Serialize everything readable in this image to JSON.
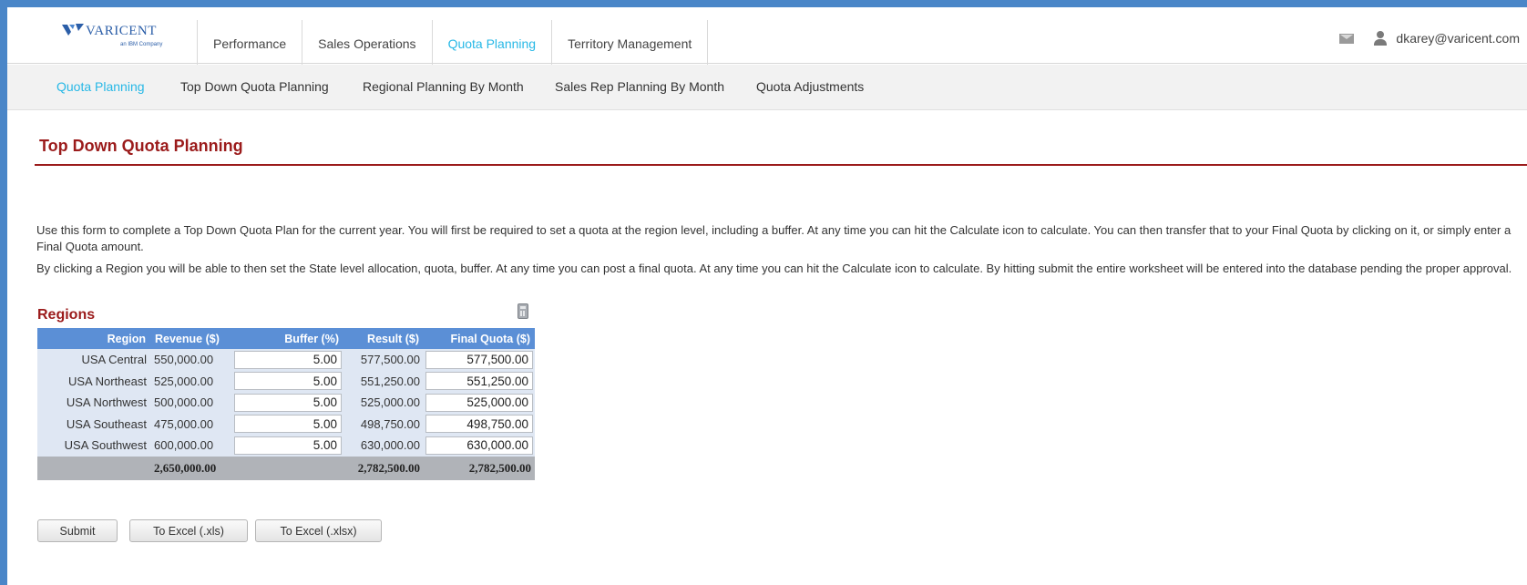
{
  "brand": {
    "name": "VARICENT",
    "tagline": "an IBM Company"
  },
  "topnav": {
    "tabs": [
      {
        "label": "Performance",
        "active": false
      },
      {
        "label": "Sales Operations",
        "active": false
      },
      {
        "label": "Quota Planning",
        "active": true
      },
      {
        "label": "Territory Management",
        "active": false
      }
    ],
    "mail_icon": "mail-icon",
    "user_icon": "user-icon",
    "user_email": "dkarey@varicent.com"
  },
  "subnav": {
    "items": [
      {
        "label": "Quota Planning",
        "active": true
      },
      {
        "label": "Top Down Quota Planning",
        "active": false
      },
      {
        "label": "Regional Planning By Month",
        "active": false
      },
      {
        "label": "Sales Rep Planning By Month",
        "active": false
      },
      {
        "label": "Quota Adjustments",
        "active": false
      }
    ]
  },
  "page": {
    "title": "Top Down Quota Planning",
    "paragraph1": "Use this form to complete a Top Down Quota Plan for the current year. You will first be required to set a quota at the region level, including a buffer. At any time you can hit the Calculate icon to calculate. You can then transfer that to your Final Quota by clicking on it, or simply enter a Final Quota amount.",
    "paragraph2": "By clicking a Region you will be able to then set the State level allocation, quota, buffer. At any time you can post a final quota. At any time you can hit the Calculate icon to calculate. By hitting submit the entire worksheet will be entered into the database pending the proper approval."
  },
  "regions": {
    "title": "Regions",
    "calculate_icon": "calculator-icon",
    "columns": [
      "Region",
      "Revenue ($)",
      "Buffer (%)",
      "Result ($)",
      "Final Quota ($)"
    ],
    "rows": [
      {
        "region": "USA Central",
        "revenue": "550,000.00",
        "buffer": "5.00",
        "result": "577,500.00",
        "final": "577,500.00"
      },
      {
        "region": "USA Northeast",
        "revenue": "525,000.00",
        "buffer": "5.00",
        "result": "551,250.00",
        "final": "551,250.00"
      },
      {
        "region": "USA Northwest",
        "revenue": "500,000.00",
        "buffer": "5.00",
        "result": "525,000.00",
        "final": "525,000.00"
      },
      {
        "region": "USA Southeast",
        "revenue": "475,000.00",
        "buffer": "5.00",
        "result": "498,750.00",
        "final": "498,750.00"
      },
      {
        "region": "USA Southwest",
        "revenue": "600,000.00",
        "buffer": "5.00",
        "result": "630,000.00",
        "final": "630,000.00"
      }
    ],
    "totals": {
      "revenue": "2,650,000.00",
      "result": "2,782,500.00",
      "final": "2,782,500.00"
    }
  },
  "buttons": {
    "submit": "Submit",
    "excel_xls": "To Excel (.xls)",
    "excel_xlsx": "To Excel (.xlsx)"
  },
  "colors": {
    "accent": "#27b8e6",
    "title_red": "#9b1b1b",
    "table_header": "#5b8fd6",
    "frame_blue": "#4a86c8"
  }
}
